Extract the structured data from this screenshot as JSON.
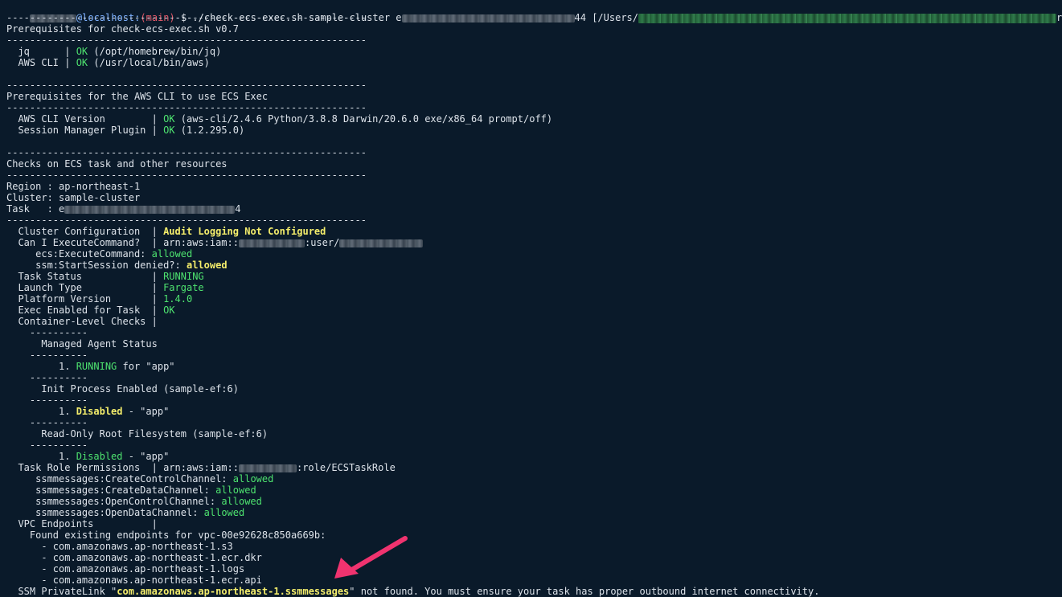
{
  "prompt": {
    "user_suffix": "@localhost:",
    "branch": "(main)",
    "command": " $ ./check-ecs-exec.sh sample-cluster e",
    "cmd_tail": "44 [/Users/",
    "path_end": "r]"
  },
  "lines": {
    "sep": "--------------------------------------------------------------",
    "prereq_title": "Prerequisites for check-ecs-exec.sh v0.7",
    "jq_label": "  jq      | ",
    "jq_ok": "OK",
    "jq_path": " (/opt/homebrew/bin/jq)",
    "awscli_label": "  AWS CLI | ",
    "awscli_ok": "OK",
    "awscli_path": " (/usr/local/bin/aws)",
    "awsprereq_title": "Prerequisites for the AWS CLI to use ECS Exec",
    "awsver_label": "  AWS CLI Version        | ",
    "awsver_ok": "OK",
    "awsver_detail": " (aws-cli/2.4.6 Python/3.8.8 Darwin/20.6.0 exe/x86_64 prompt/off)",
    "smp_label": "  Session Manager Plugin | ",
    "smp_ok": "OK",
    "smp_detail": " (1.2.295.0)",
    "checks_title": "Checks on ECS task and other resources",
    "region": "Region : ap-northeast-1",
    "cluster": "Cluster: sample-cluster",
    "task_label": "Task   : e",
    "task_tail": "4",
    "cluster_cfg_label": "  Cluster Configuration  | ",
    "cluster_cfg_value": "Audit Logging Not Configured",
    "can_exec_label": "  Can I ExecuteCommand?  | arn:aws:iam::",
    "can_exec_mid": ":user/",
    "ecs_exec_label": "     ecs:ExecuteCommand: ",
    "ecs_exec_value": "allowed",
    "ssm_start_label": "     ssm:StartSession denied?: ",
    "ssm_start_value": "allowed",
    "task_status_label": "  Task Status            | ",
    "task_status_value": "RUNNING",
    "launch_type_label": "  Launch Type            | ",
    "launch_type_value": "Fargate",
    "platform_label": "  Platform Version       | ",
    "platform_value": "1.4.0",
    "exec_enabled_label": "  Exec Enabled for Task  | ",
    "exec_enabled_value": "OK",
    "container_checks": "  Container-Level Checks |",
    "sub_sep": "    ----------",
    "managed_agent": "      Managed Agent Status",
    "ma_item_prefix": "         1. ",
    "ma_item_value": "RUNNING",
    "ma_item_suffix": " for \"app\"",
    "init_process": "      Init Process Enabled (sample-ef:6)",
    "ip_item_prefix": "         1. ",
    "ip_item_value": "Disabled",
    "ip_item_suffix": " - \"app\"",
    "readonly_root": "      Read-Only Root Filesystem (sample-ef:6)",
    "ro_item_prefix": "         1. ",
    "ro_item_value": "Disabled",
    "ro_item_suffix": " - \"app\"",
    "task_role_label": "  Task Role Permissions  | arn:aws:iam::",
    "task_role_tail": ":role/ECSTaskRole",
    "perm1_label": "     ssmmessages:CreateControlChannel: ",
    "perm1_value": "allowed",
    "perm2_label": "     ssmmessages:CreateDataChannel: ",
    "perm2_value": "allowed",
    "perm3_label": "     ssmmessages:OpenControlChannel: ",
    "perm3_value": "allowed",
    "perm4_label": "     ssmmessages:OpenDataChannel: ",
    "perm4_value": "allowed",
    "vpc_label": "  VPC Endpoints          |",
    "found_endpoints": "    Found existing endpoints for vpc-00e92628c850a669b:",
    "ep1": "      - com.amazonaws.ap-northeast-1.s3",
    "ep2": "      - com.amazonaws.ap-northeast-1.ecr.dkr",
    "ep3": "      - com.amazonaws.ap-northeast-1.logs",
    "ep4": "      - com.amazonaws.ap-northeast-1.ecr.api",
    "ssm_pl_prefix": "  SSM PrivateLink \"",
    "ssm_pl_value": "com.amazonaws.ap-northeast-1.ssmmessages",
    "ssm_pl_suffix": "\" not found. You must ensure your task has proper outbound internet connectivity."
  },
  "colors": {
    "background": "#0a1a2a",
    "text": "#dde3ea",
    "ok_green": "#4ee36f",
    "warn_yellow": "#f4ed6b",
    "arrow_pink": "#f0336f"
  }
}
